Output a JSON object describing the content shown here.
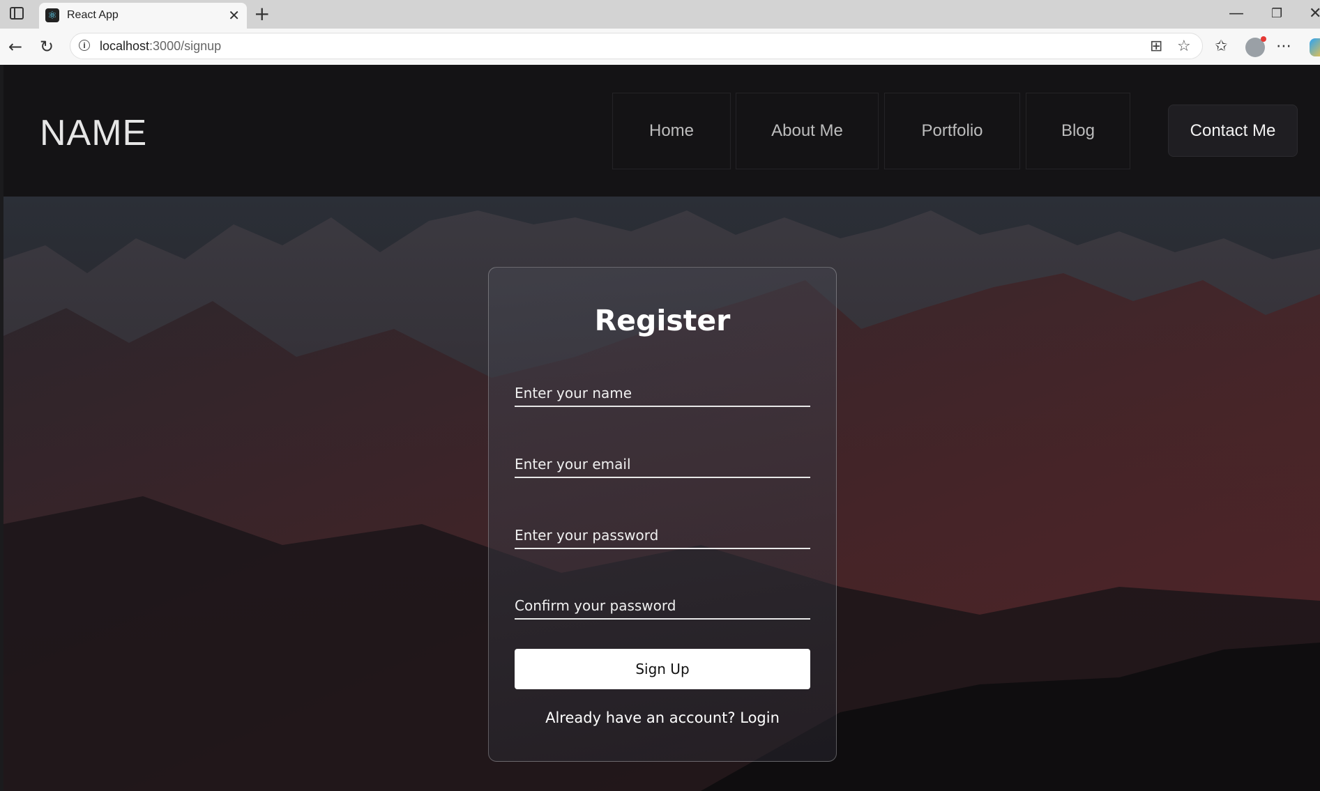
{
  "browser": {
    "tab_title": "React App",
    "url_host": "localhost",
    "url_path": ":3000/signup"
  },
  "navbar": {
    "logo": "NAME",
    "links": [
      "Home",
      "About Me",
      "Portfolio",
      "Blog"
    ],
    "cta": "Contact Me"
  },
  "form": {
    "title": "Register",
    "name_placeholder": "Enter your name",
    "email_placeholder": "Enter your email",
    "password_placeholder": "Enter your password",
    "confirm_placeholder": "Confirm your password",
    "submit_label": "Sign Up",
    "login_prompt": "Already have an account?",
    "login_link": "Login"
  },
  "colors": {
    "navbar_bg": "#141315",
    "accent_button": "#ffffff",
    "text": "#ffffff"
  }
}
